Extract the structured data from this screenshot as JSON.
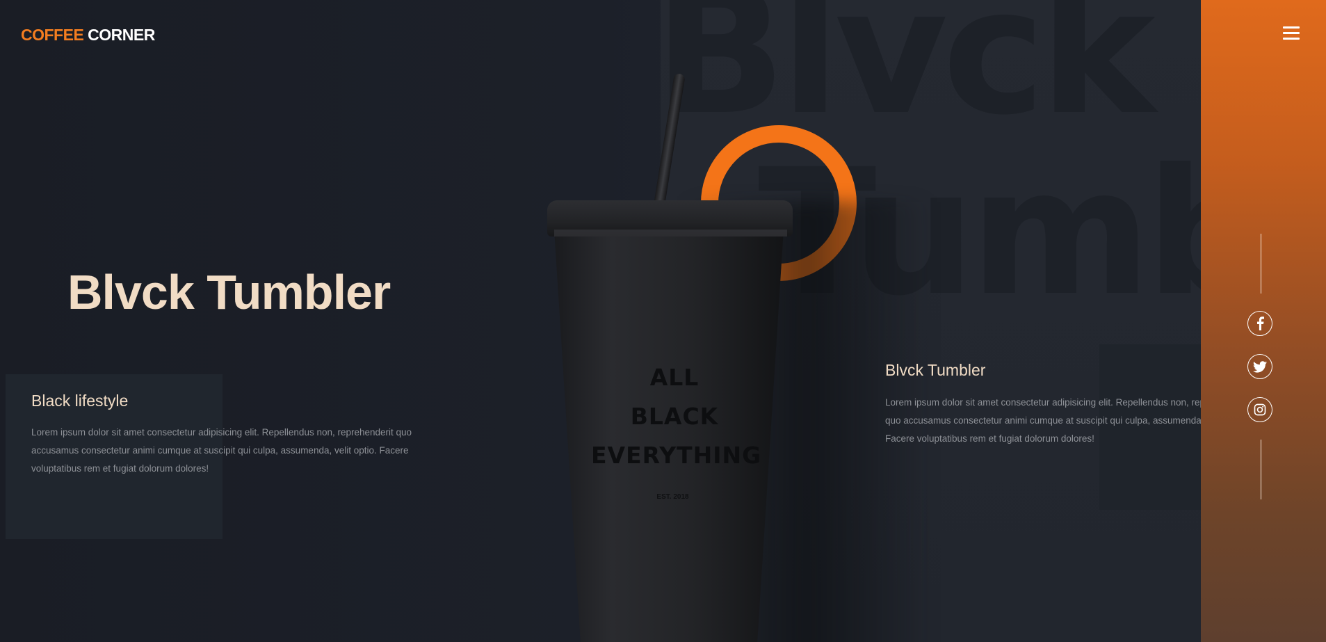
{
  "brand": {
    "logo_accent": "COFFEE",
    "logo_rest": "CORNER",
    "accent_color": "#f47d20"
  },
  "hero": {
    "title": "Blvck Tumbler",
    "background_word_top": "Blvck",
    "background_word_bottom": "Tumbler"
  },
  "lifestyle": {
    "title": "Black lifestyle",
    "text": "Lorem ipsum dolor sit amet consectetur adipisicing elit. Repellendus non, reprehenderit quo accusamus consectetur animi cumque at suscipit qui culpa, assumenda, velit optio. Facere voluptatibus rem et fugiat dolorum dolores!"
  },
  "product": {
    "cup_text_line1": "ALL",
    "cup_text_line2": "BLACK",
    "cup_text_line3": "EVERYTHING",
    "cup_est": "EST. 2018"
  },
  "info": {
    "title": "Blvck Tumbler",
    "text": "Lorem ipsum dolor sit amet consectetur adipisicing elit. Repellendus non, reprehenderit quo accusamus consectetur animi cumque at suscipit qui culpa, assumenda, velit optio. Facere voluptatibus rem et fugiat dolorum dolores!"
  },
  "sidebar": {
    "menu_icon": "hamburger-menu-icon",
    "socials": [
      {
        "name": "facebook-icon"
      },
      {
        "name": "twitter-icon"
      },
      {
        "name": "instagram-icon"
      }
    ]
  }
}
